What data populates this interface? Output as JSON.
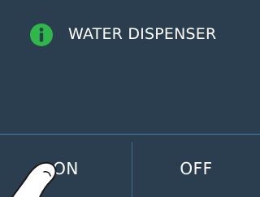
{
  "header": {
    "icon": "info-icon",
    "title": "WATER DISPENSER"
  },
  "controls": {
    "on_label": "ON",
    "off_label": "OFF"
  },
  "colors": {
    "background": "#2b3e50",
    "icon_green": "#2eb84a",
    "divider": "#3e7fa8",
    "text": "#ffffff"
  }
}
